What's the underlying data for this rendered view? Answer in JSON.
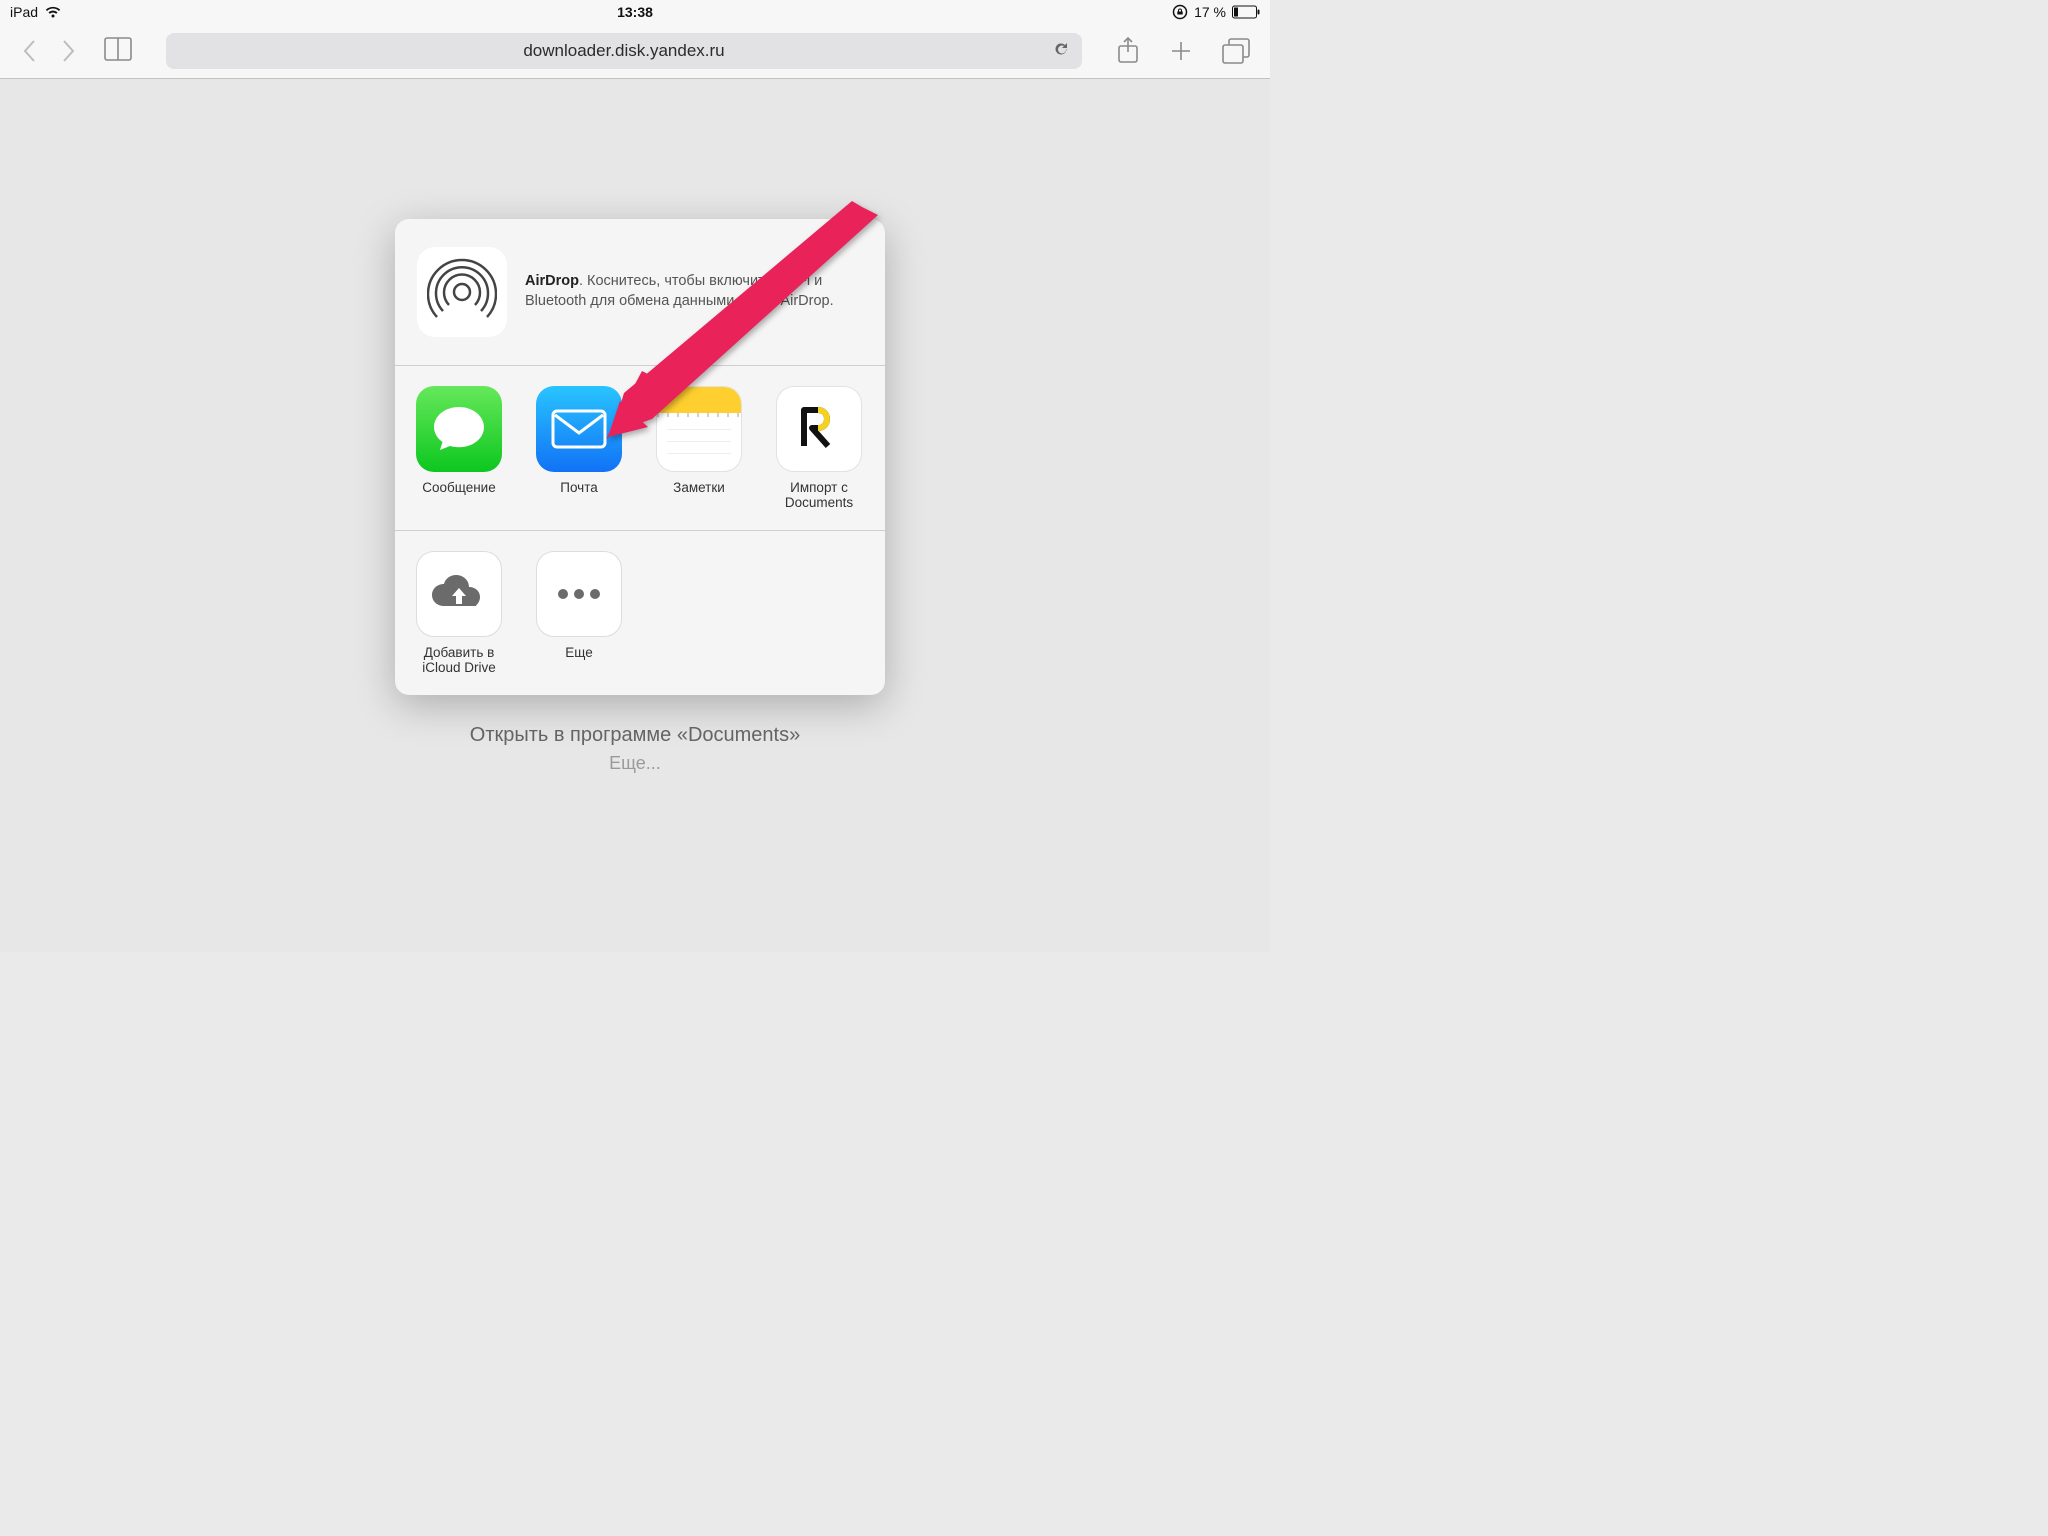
{
  "status_bar": {
    "device": "iPad",
    "time": "13:38",
    "battery_percent": "17 %"
  },
  "toolbar": {
    "url": "downloader.disk.yandex.ru"
  },
  "share_sheet": {
    "airdrop": {
      "title": "AirDrop",
      "body_after": ". Коснитесь, чтобы включить Wi-Fi и Bluetooth для обмена данными через AirDrop."
    },
    "share_items": [
      {
        "label": "Сообщение"
      },
      {
        "label": "Почта"
      },
      {
        "label": "Заметки"
      },
      {
        "label": "Импорт с Documents"
      }
    ],
    "action_items": [
      {
        "label": "Добавить в iCloud Drive"
      },
      {
        "label": "Еще"
      }
    ]
  },
  "background": {
    "line1": "Открыть в программе «Documents»",
    "line2": "Еще..."
  }
}
